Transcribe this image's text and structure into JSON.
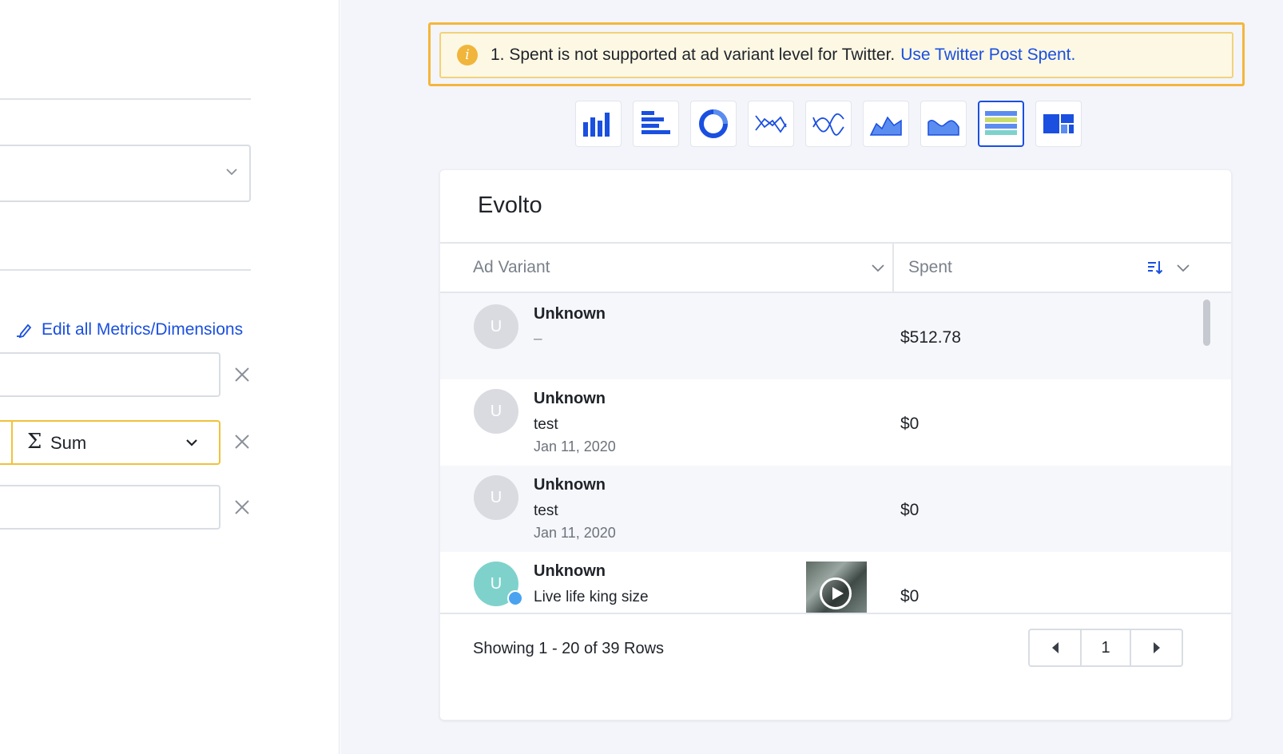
{
  "left_panel": {
    "edit_all_label": "Edit all Metrics/Dimensions",
    "aggregation_label": "Sum",
    "aggregation_symbol": "Σ"
  },
  "warning": {
    "text": "1. Spent is not supported at ad variant level for Twitter.",
    "link": "Use Twitter Post Spent.",
    "icon": "i"
  },
  "chart_types": [
    {
      "name": "vertical-bar-chart-icon",
      "active": false
    },
    {
      "name": "horizontal-bar-chart-icon",
      "active": false
    },
    {
      "name": "donut-chart-icon",
      "active": false
    },
    {
      "name": "line-chart-icon",
      "active": false
    },
    {
      "name": "smooth-line-chart-icon",
      "active": false
    },
    {
      "name": "area-chart-icon",
      "active": false
    },
    {
      "name": "smooth-area-chart-icon",
      "active": false
    },
    {
      "name": "table-chart-icon",
      "active": true
    },
    {
      "name": "treemap-chart-icon",
      "active": false
    }
  ],
  "card": {
    "title": "Evolto",
    "columns": {
      "ad_variant": "Ad Variant",
      "spent": "Spent"
    },
    "rows": [
      {
        "avatar": "U",
        "name": "Unknown",
        "sub": "–",
        "date": "",
        "spent": "$512.78"
      },
      {
        "avatar": "U",
        "name": "Unknown",
        "sub": "test",
        "date": "Jan 11, 2020",
        "spent": "$0"
      },
      {
        "avatar": "U",
        "name": "Unknown",
        "sub": "test",
        "date": "Jan 11, 2020",
        "spent": "$0"
      },
      {
        "avatar": "U",
        "name": "Unknown",
        "sub": "Live life king size",
        "date": "",
        "spent": "$0"
      }
    ],
    "footer": {
      "showing": "Showing 1 - 20 of 39 Rows",
      "page": "1"
    }
  },
  "colors": {
    "accent": "#1a4fe0",
    "warning_border": "#f5b63c",
    "highlight": "#f0c23a"
  }
}
